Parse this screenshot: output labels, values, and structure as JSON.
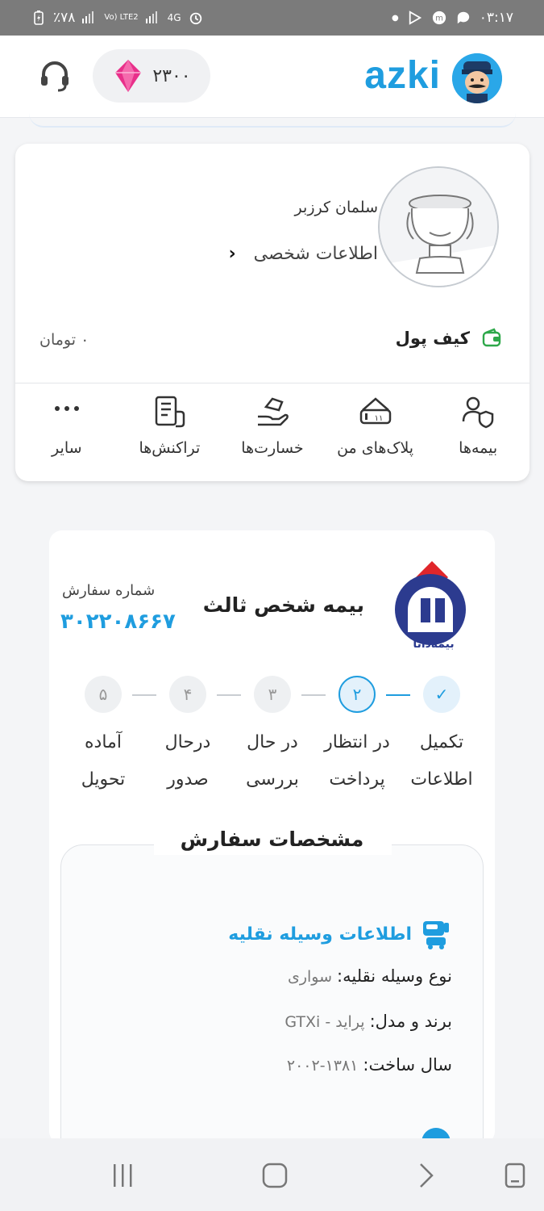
{
  "status_bar": {
    "battery": "٪۷۸",
    "network": "Vo) LTE2",
    "gen": "4G",
    "time": "۰۳:۱۷"
  },
  "app_bar": {
    "brand": "azki",
    "points": "۲۳۰۰",
    "icons": [
      "avatar-logo",
      "diamond-icon",
      "headset-icon"
    ]
  },
  "profile": {
    "name": "سلمان کرزبر",
    "info_link": "اطلاعات شخصی",
    "wallet_label": "کیف پول",
    "wallet_amount": "۰ تومان"
  },
  "quick_actions": [
    {
      "label": "بیمه‌ها",
      "icon": "insurance-users-icon"
    },
    {
      "label": "پلاک‌های من",
      "icon": "plate-icon"
    },
    {
      "label": "خسارت‌ها",
      "icon": "claims-hand-icon"
    },
    {
      "label": "تراکنش‌ها",
      "icon": "transactions-icon"
    },
    {
      "label": "سایر",
      "icon": "more-icon"
    }
  ],
  "order": {
    "insurer_logo_text": "بیمه‌دانا",
    "title": "بیمه شخص ثالث",
    "order_label": "شماره سفارش",
    "order_number": "۳۰۲۲۰۸۶۶۷",
    "steps": [
      {
        "num": "✓",
        "label_1": "تکمیل",
        "label_2": "اطلاعات",
        "state": "done"
      },
      {
        "num": "۲",
        "label_1": "در انتظار",
        "label_2": "پرداخت",
        "state": "active"
      },
      {
        "num": "۳",
        "label_1": "در حال",
        "label_2": "بررسی",
        "state": "pending"
      },
      {
        "num": "۴",
        "label_1": "درحال",
        "label_2": "صدور",
        "state": "pending"
      },
      {
        "num": "۵",
        "label_1": "آماده",
        "label_2": "تحویل",
        "state": "pending"
      }
    ],
    "spec_title": "مشخصات سفارش",
    "vehicle_section_title": "اطلاعات وسیله نقلیه",
    "vehicle_type_label": "نوع وسیله نقلیه:",
    "vehicle_type_value": "سواری",
    "brand_label": "برند و مدل:",
    "brand_value": "پراید - GTXi",
    "year_label": "سال ساخت:",
    "year_value": "۱۳۸۱-۲۰۰۲"
  },
  "colors": {
    "accent": "#1f9ddf",
    "diamond": "#e8308a",
    "insurer_blue": "#2c3b8f",
    "insurer_red": "#e0262b",
    "wallet_green": "#2ea84a"
  }
}
